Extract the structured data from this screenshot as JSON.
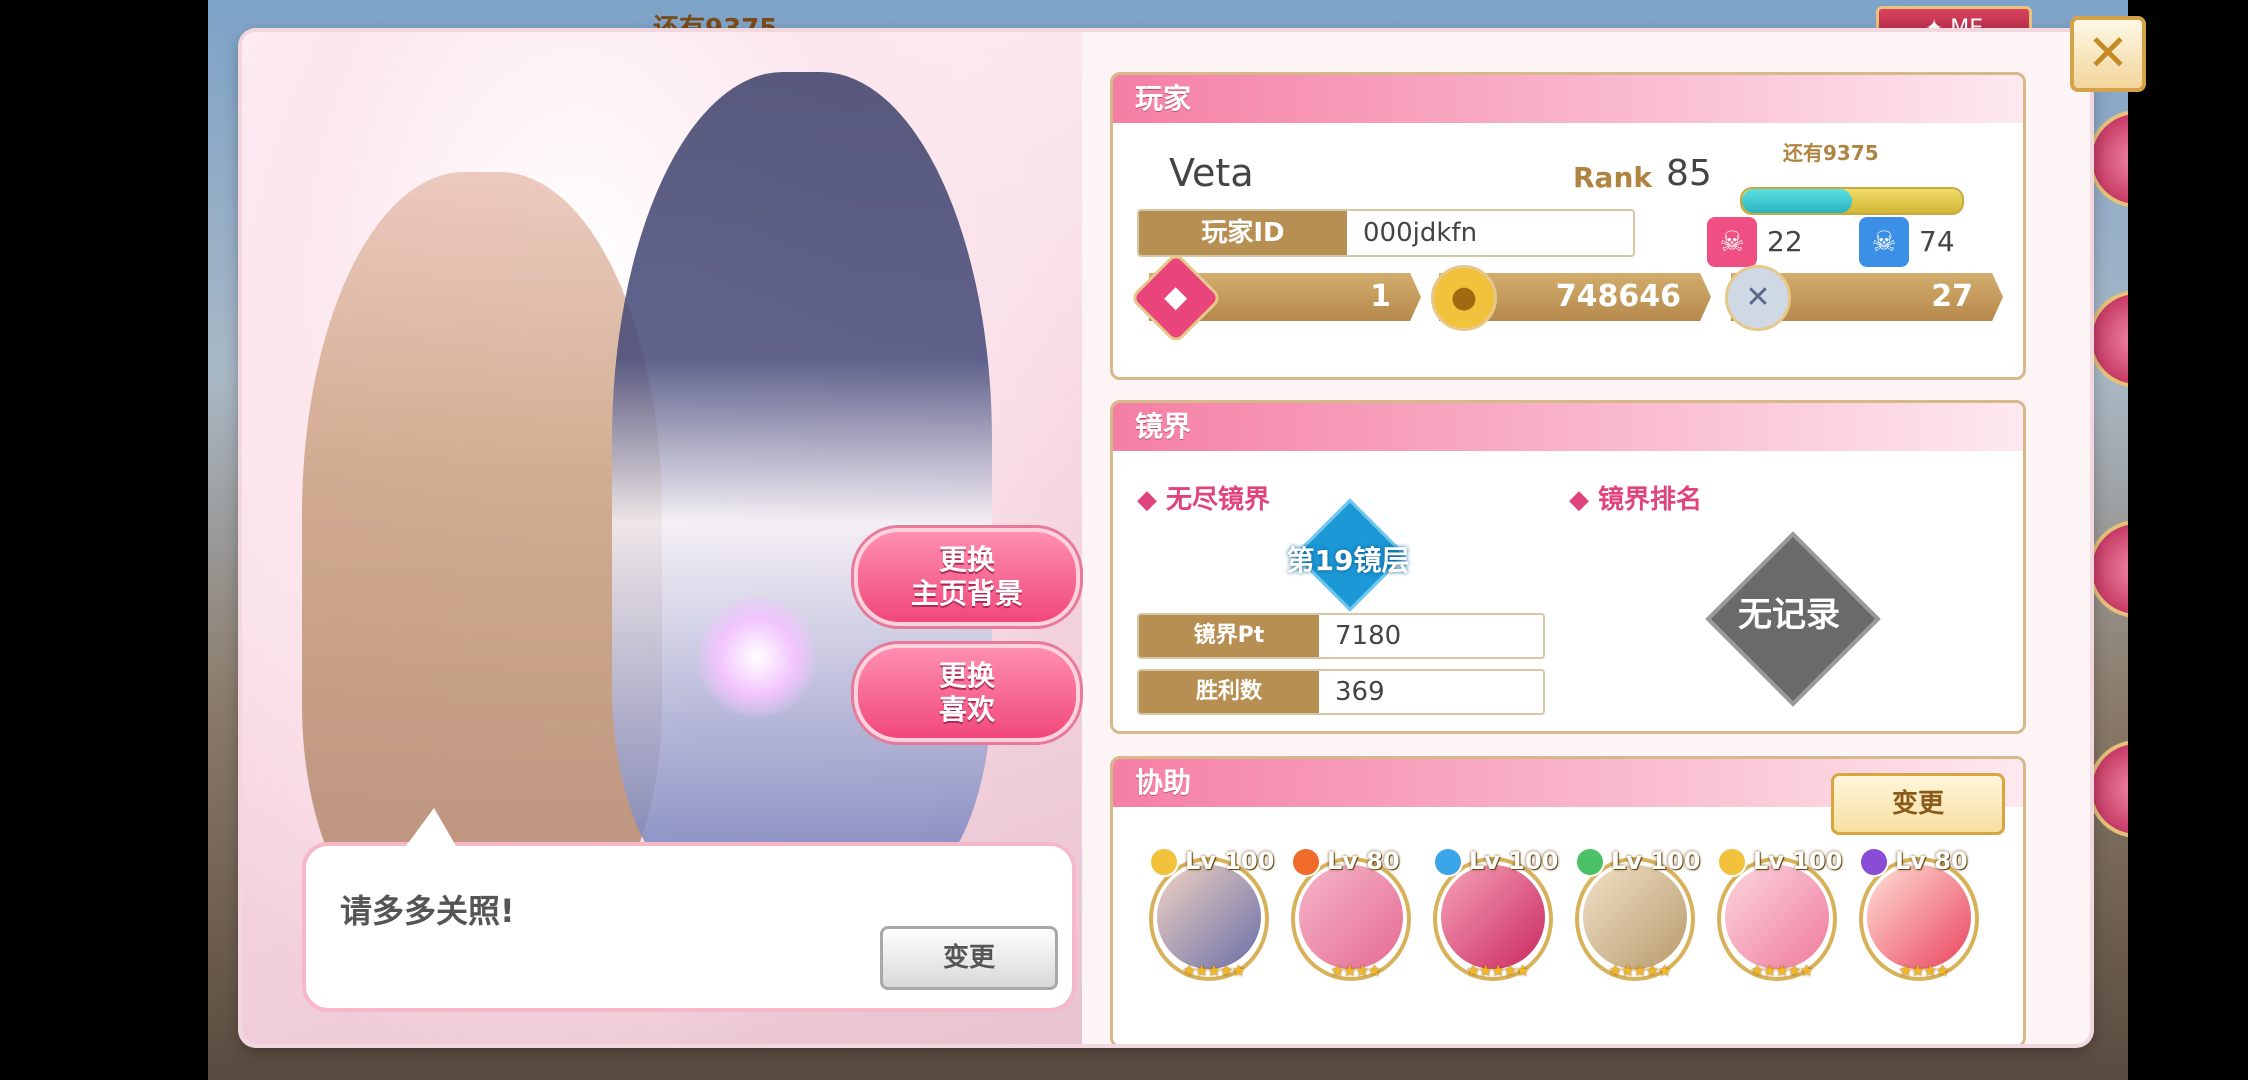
{
  "background": {
    "top_hint": "还有9375",
    "top_right_button": "✦ ME"
  },
  "left_panel": {
    "change_bg_button": {
      "line1": "更换",
      "line2": "主页背景"
    },
    "change_fav_button": {
      "line1": "更换",
      "line2": "喜欢"
    },
    "greeting": "请多多关照!",
    "greeting_change_button": "变更"
  },
  "player": {
    "section_title": "玩家",
    "name": "Veta",
    "rank_label": "Rank",
    "rank": "85",
    "exp_remaining": "还有9375",
    "exp_fraction": 0.5,
    "id_label": "玩家ID",
    "id_value": "000jdkfn",
    "pink_stat": "22",
    "blue_stat": "74",
    "currencies": {
      "gems": "1",
      "coins": "748646",
      "ap": "27"
    }
  },
  "mirror": {
    "section_title": "镜界",
    "endless_label": "无尽镜界",
    "ranking_label": "镜界排名",
    "floor_badge": "第19镜层",
    "pt_label": "镜界Pt",
    "pt_value": "7180",
    "wins_label": "胜利数",
    "wins_value": "369",
    "no_record": "无记录"
  },
  "assist": {
    "section_title": "协助",
    "change_button": "变更",
    "members": [
      {
        "level": "Lv 100",
        "element": "light",
        "element_color": "#f2c23c",
        "stars": "★★★★★"
      },
      {
        "level": "Lv 80",
        "element": "fire",
        "element_color": "#f06a2a",
        "stars": "★★★★"
      },
      {
        "level": "Lv 100",
        "element": "water",
        "element_color": "#3aa6e8",
        "stars": "★★★★★"
      },
      {
        "level": "Lv 100",
        "element": "forest",
        "element_color": "#4cc266",
        "stars": "★★★★★"
      },
      {
        "level": "Lv 100",
        "element": "light",
        "element_color": "#f2c23c",
        "stars": "★★★★★"
      },
      {
        "level": "Lv 80",
        "element": "dark",
        "element_color": "#8a4bd6",
        "stars": "★★★★"
      }
    ]
  },
  "close_glyph": "✕"
}
